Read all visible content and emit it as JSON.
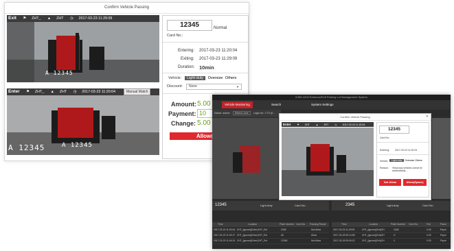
{
  "back_dialog": {
    "title": "Confirm Vehicle Passing",
    "exit_camera": {
      "label": "Exit",
      "overlay_a": "ZHT_",
      "overlay_b": "ZHT",
      "datetime": "2017-03-23   11:29:09",
      "plate_text": "A 12345"
    },
    "enter_camera": {
      "label": "Enter",
      "overlay_a": "ZHT_",
      "overlay_b": "ZHT",
      "datetime": "2017-03-23   11:20:04",
      "manual_match": "Manual Match",
      "plate_text": "A 12345",
      "plate_text_2": "A 12345"
    },
    "info": {
      "plate": "12345",
      "plate_type": "Normal",
      "card_no_label": "Card No.:",
      "entering_label": "Entering:",
      "entering_value": "2017-03-23   11:20:04",
      "exiting_label": "Exiting:",
      "exiting_value": "2017-03-23   11:29:09",
      "duration_label": "Duration:",
      "duration_value": "10min",
      "vehicle_label": "Vehicle:",
      "vehicle_options": [
        "Light-duty",
        "Oversize",
        "Others"
      ],
      "vehicle_selected": "Light-duty",
      "discount_label": "Discount:",
      "discount_value": "None",
      "amount_label": "Amount:",
      "amount_value": "5.00",
      "payment_label": "Payment:",
      "payment_value": "10",
      "change_label": "Change:",
      "change_value": "5.00",
      "allow_button": "Allow(En"
    }
  },
  "front_screenshot": {
    "window_title": "iVMS-4200 Entrance/Exit Parking Lot Management System",
    "nav": {
      "vehicle_monitoring": "Vehicle Monitoring",
      "search": "Search",
      "system_settings": "System Settings"
    },
    "bar_left": {
      "user_label": "Name:",
      "user_value": "admin",
      "select_lane": "Select Lane",
      "login_for": "Login for:",
      "login_value": "1'70 (K..."
    },
    "dialog": {
      "title": "Confirm Vehicle Passing",
      "enter_label": "Enter",
      "overlay_a": "ZHT",
      "overlay_b": "ZHT",
      "datetime": "2017-03-23   11:20:04",
      "plate": "12345",
      "card_no_label": "Card No.:",
      "entering_label": "Entering:",
      "entering_value": "2017-03-23   11:20:04",
      "vehicle_label": "Vehicle:",
      "vehicle_options": [
        "Light-duty",
        "Oversize",
        "Others"
      ],
      "vehicle_selected": "Light-duty",
      "reason_label": "Reason:",
      "reason_value": "Temporary vehicles cannot be automatically...",
      "not_allow": "Not Allow",
      "allow_space": "Allow(Space)"
    },
    "lane_left": {
      "plate": "12345",
      "type": "Light-duty",
      "card": "Card No.:"
    },
    "lane_right": {
      "plate": "2345",
      "type": "Light-duty",
      "card": "Card No.:"
    },
    "table_headers": [
      "Time",
      "Location",
      "Plate Number",
      "Card No.",
      "Passing Result"
    ],
    "table_left_rows": [
      [
        "2017-03-23 11:20:04",
        "ZHT_(ignore)(Enter)ZHT_Ent",
        "2345",
        "",
        "Not Allow"
      ],
      [
        "2017-03-23 11:09:17",
        "ZHT_(ignore)(Enter)ZHT_Ent",
        "A0",
        "",
        "Allow"
      ],
      [
        "2017-03-23 11:04:24",
        "ZHT_(ignore)(Enter)ZHT_Ent",
        "12345",
        "",
        "Not Allow"
      ]
    ],
    "table_right_rows": [
      [
        "2017-03-23 11:29:09",
        "ZHT_(ignore)(Exit)ZH",
        "2345",
        "",
        "0.00",
        "Paym"
      ],
      [
        "2017-03-18 09:14:55",
        "ZHT_(ignore)(Exit)ZH",
        "H",
        "",
        "0.00",
        "Paym"
      ],
      [
        "2017-03-18 09:05:22",
        "ZHT_(ignore)(Exit)ZH",
        "0",
        "",
        "0.00",
        "Paym"
      ]
    ],
    "table_right_headers": [
      "Time",
      "Location",
      "Plate Number",
      "Card No.",
      "Fee",
      "Passi"
    ]
  }
}
